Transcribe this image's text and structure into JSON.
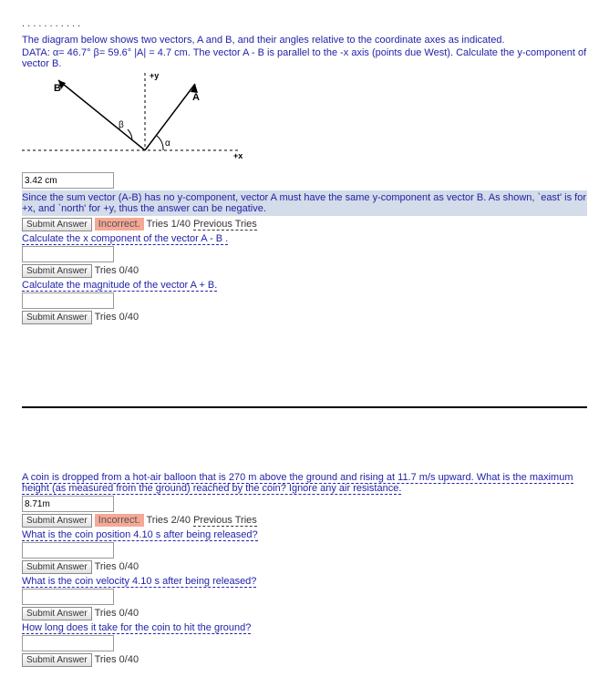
{
  "problem1": {
    "top_partial": ". . . . . . . . . . .",
    "intro": "The diagram below shows two vectors, A and B, and their angles relative to the coordinate axes as indicated.",
    "data": "DATA: α= 46.7° β= 59.6° |A| = 4.7 cm. The vector A - B is parallel to the -x axis (points due West). Calculate the y-component of vector B.",
    "y_label": "+y",
    "x_label": "+x",
    "vecA": "A",
    "vecB": "B",
    "alpha_sym": "α",
    "beta_sym": "β",
    "input1": "3.42 cm",
    "feedback": "Since the sum vector (A-B) has no y-component, vector A must have the same y-component as vector B. As shown, `east' is for +x, and `north' for +y, thus the answer can be negative.",
    "submit": "Submit Answer",
    "incorrect": "Incorrect.",
    "tries1": "Tries 1/40",
    "prev": "Previous Tries",
    "q2": "Calculate the x component of the vector A - B .",
    "tries0": "Tries 0/40",
    "q3": "Calculate the magnitude of the vector A + B."
  },
  "problem2": {
    "intro": "A coin is dropped from a hot-air balloon that is 270 m above the ground and rising at 11.7 m/s upward. What is the maximum height (as measured from the ground) reached by the coin? Ignore any air resistance.",
    "input1": "8.71m",
    "submit": "Submit Answer",
    "incorrect": "Incorrect.",
    "tries2": "Tries 2/40",
    "prev": "Previous Tries",
    "q2": "What is the coin position 4.10 s after being released?",
    "tries0": "Tries 0/40",
    "q3": "What is the coin velocity 4.10 s after being released?",
    "q4": "How long does it take for the coin to hit the ground?"
  }
}
